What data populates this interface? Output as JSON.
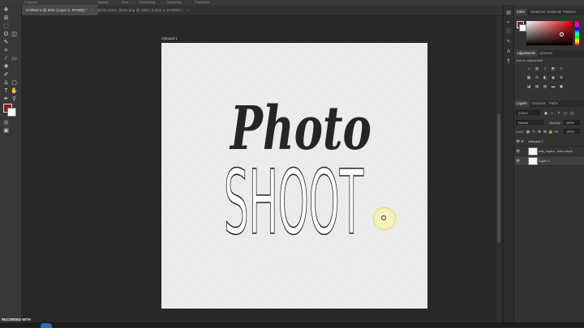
{
  "options_bar": {
    "items": [
      "Frequent",
      "Opacity",
      "Flow",
      "Smoothing",
      "Symmetry",
      "Properties"
    ]
  },
  "tabs": [
    {
      "label": "Untitled-2 @ 50% (Layer 1, RGB/8) *",
      "active": true
    },
    {
      "label": "photo shoot_black.png @ 100% (Layer 1, RGB/8*) *",
      "active": false
    }
  ],
  "artboard": {
    "label": "Artboard 1"
  },
  "canvas_text": {
    "line1": "Photo",
    "line2": "SHOOT"
  },
  "panels": {
    "color_tabs": [
      "Color",
      "Swatches",
      "Gradients",
      "Patterns"
    ],
    "adjustments_tabs": [
      "Adjustments",
      "Libraries"
    ],
    "adjustments_hint": "Add an adjustment",
    "layers_tabs": [
      "Layers",
      "Channels",
      "Paths"
    ],
    "layers_filter": "Q Kind",
    "blend_mode": "Normal",
    "opacity_label": "Opacity:",
    "opacity_value": "100%",
    "lock_label": "Lock:",
    "fill_label": "Fill:",
    "fill_value": "100%",
    "layers": [
      {
        "name": "Artboard 1",
        "selected": false
      },
      {
        "name": "raw_captur...hoto shoot",
        "selected": false
      },
      {
        "name": "Layer 1",
        "selected": true
      }
    ]
  },
  "colors": {
    "foreground": "#8a1d1d",
    "background": "#ffffff",
    "canvas_bg": "#282828",
    "cursor_highlight": "#fff59a"
  },
  "recording": {
    "label": "RECORDED WITH"
  }
}
